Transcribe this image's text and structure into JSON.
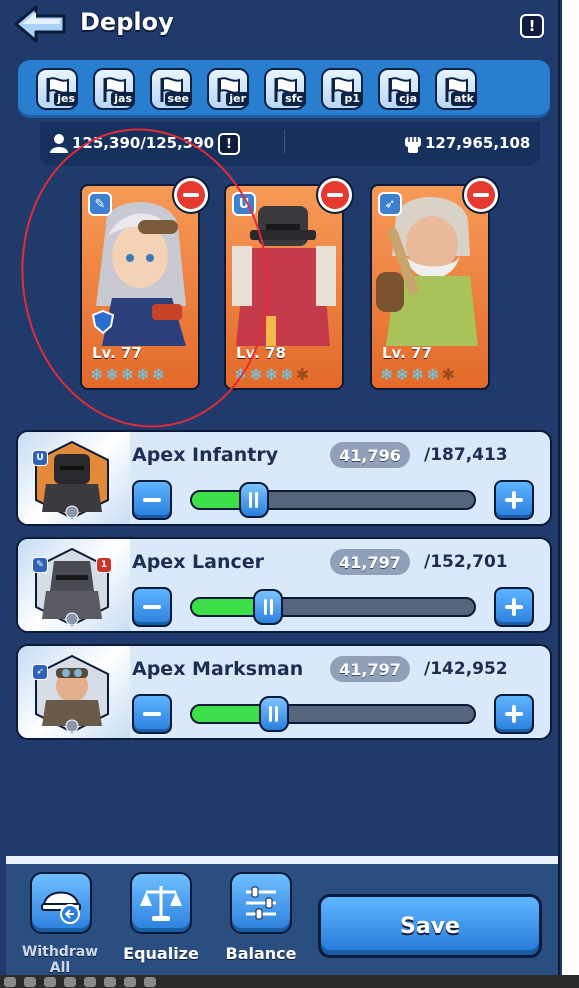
{
  "header": {
    "title": "Deploy",
    "info_icon": "exclamation-icon"
  },
  "flags": [
    "jes",
    "jas",
    "see",
    "jer",
    "sfc",
    "p1",
    "cja",
    "atk"
  ],
  "stats": {
    "troops": "125,390/125,390",
    "power": "127,965,108"
  },
  "heroes": [
    {
      "level": "Lv. 77",
      "stars": 5,
      "max_stars": 5,
      "class_icon": "wand-icon"
    },
    {
      "level": "Lv. 78",
      "stars": 4,
      "max_stars": 5,
      "class_icon": "shield-icon"
    },
    {
      "level": "Lv. 77",
      "stars": 4,
      "max_stars": 5,
      "class_icon": "bow-icon"
    }
  ],
  "troops": [
    {
      "name": "Apex Infantry",
      "count": "41,796",
      "max": "/187,413",
      "fill": 0.223
    },
    {
      "name": "Apex Lancer",
      "count": "41,797",
      "max": "/152,701",
      "fill": 0.274
    },
    {
      "name": "Apex Marksman",
      "count": "41,797",
      "max": "/142,952",
      "fill": 0.292
    }
  ],
  "bottom": {
    "withdraw_label": "Withdraw All",
    "equalize_label": "Equalize",
    "balance_label": "Balance",
    "save_label": "Save"
  },
  "colors": {
    "accent": "#2a7fdc",
    "panel": "#1f3a6b",
    "fill": "#3ee04a",
    "remove": "#e53a2f"
  }
}
